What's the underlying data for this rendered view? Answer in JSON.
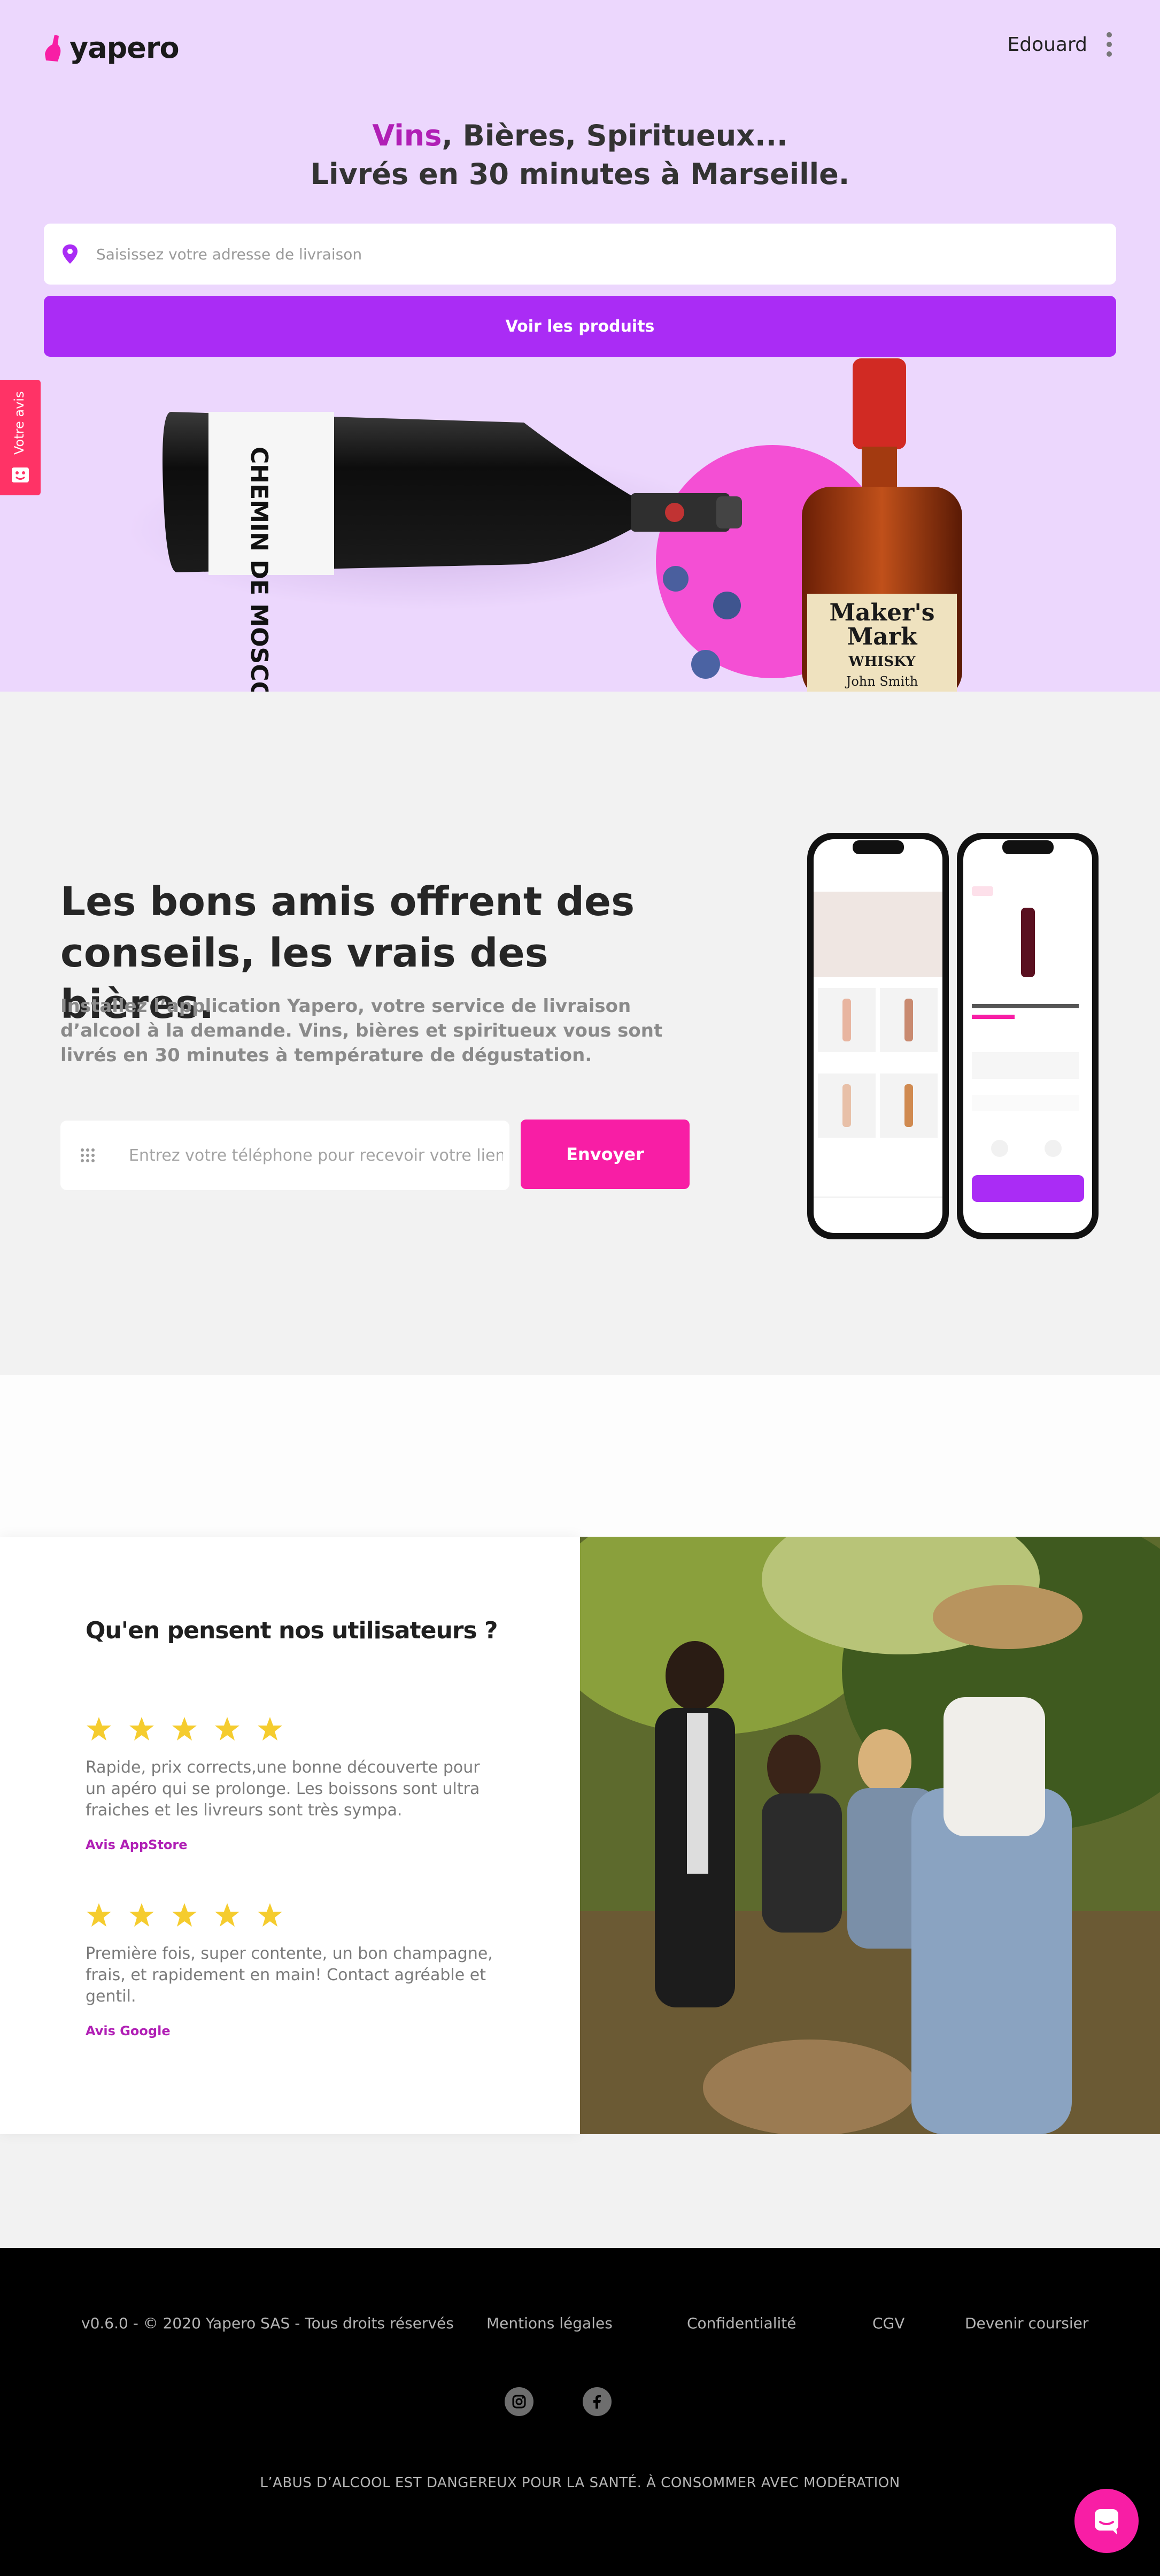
{
  "header": {
    "brand": "yapero",
    "user_name": "Edouard"
  },
  "hero": {
    "headline_accent": "Vins",
    "headline_rest": ", Bières, Spiritueux...",
    "headline_line2": "Livrés en 30 minutes à Marseille.",
    "address_placeholder": "Saisissez votre adresse de livraison",
    "cta_label": "Voir les produits",
    "bottle_label_wine": "CHEMIN DE MOSCOU",
    "bottle_label_whisky_line1": "Maker's",
    "bottle_label_whisky_line2": "Mark",
    "bottle_label_whisky_line3": "WHISKY",
    "bottle_label_whisky_line4": "John Smith"
  },
  "feedback_tab": {
    "label": "Votre avis"
  },
  "app_section": {
    "title": "Les bons amis offrent des conseils, les vrais des bières.",
    "description": "Installez l’application Yapero, votre service de livraison d’alcool à la demande. Vins, bières et spiritueux vous sont livrés en 30 minutes à température de dégustation.",
    "phone_placeholder": "Entrez votre téléphone pour recevoir votre lien",
    "send_label": "Envoyer"
  },
  "reviews": {
    "title": "Qu'en pensent nos utilisateurs ?",
    "items": [
      {
        "rating": 5,
        "text": "Rapide, prix corrects,une bonne découverte pour un apéro qui se prolonge. Les boissons sont ultra fraiches et les livreurs sont très sympa.",
        "source": "Avis AppStore"
      },
      {
        "rating": 5,
        "text": "Première fois, super contente, un bon champagne, frais, et rapidement en main! Contact agréable et gentil.",
        "source": "Avis Google"
      }
    ]
  },
  "footer": {
    "copyright": "v0.6.0 - © 2020 Yapero SAS - Tous droits réservés",
    "links": [
      "Mentions légales",
      "Confidentialité",
      "CGV",
      "Devenir coursier"
    ],
    "social": [
      "instagram-icon",
      "facebook-icon"
    ],
    "warning": "L’ABUS D’ALCOOL EST DANGEREUX POUR LA SANTÉ. À CONSOMMER AVEC MODÉRATION"
  },
  "colors": {
    "hero_bg": "#ecd7fd",
    "accent_purple": "#aa2cf5",
    "accent_magenta": "#b01fb5",
    "accent_pink": "#f81ea5",
    "feedback_red": "#ff3366",
    "star_yellow": "#f5cc2e"
  }
}
